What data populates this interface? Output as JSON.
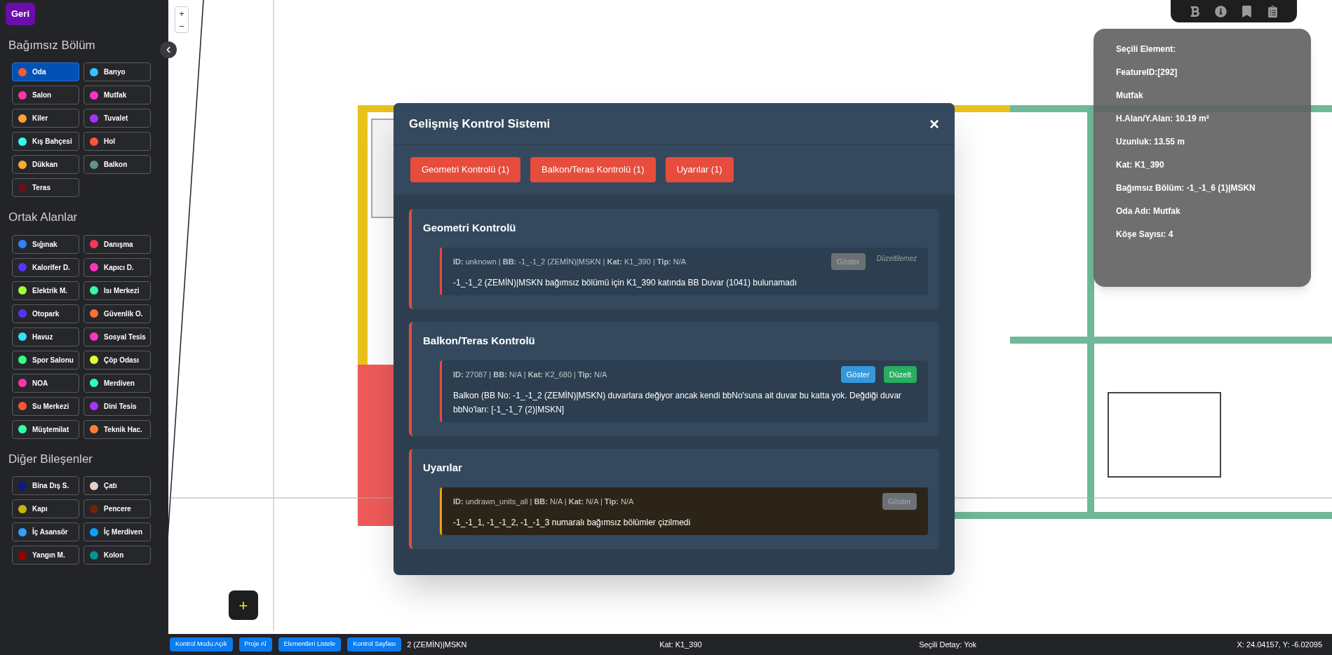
{
  "back_button": "Geri",
  "groups": [
    {
      "title": "Bağımsız Bölüm",
      "items": [
        {
          "label": "Oda",
          "color": "#ff5733",
          "selected": true
        },
        {
          "label": "Banyo",
          "color": "#33c4ff",
          "selected": false
        },
        {
          "label": "Salon",
          "color": "#ff33a8",
          "selected": false
        },
        {
          "label": "Mutfak",
          "color": "#ff33c4",
          "selected": false
        },
        {
          "label": "Kiler",
          "color": "#ffa033",
          "selected": false
        },
        {
          "label": "Tuvalet",
          "color": "#a833ff",
          "selected": false
        },
        {
          "label": "Kış Bahçesi",
          "color": "#33fff0",
          "selected": false
        },
        {
          "label": "Hol",
          "color": "#ff5733",
          "selected": false
        },
        {
          "label": "Dükkan",
          "color": "#ffaa33",
          "selected": false
        },
        {
          "label": "Balkon",
          "color": "#5f9490",
          "selected": false
        },
        {
          "label": "Teras",
          "color": "#6b0f1e",
          "selected": false
        }
      ]
    },
    {
      "title": "Ortak Alanlar",
      "items": [
        {
          "label": "Sığınak",
          "color": "#3380ff",
          "selected": false
        },
        {
          "label": "Danışma",
          "color": "#ff3358",
          "selected": false
        },
        {
          "label": "Kalorifer D.",
          "color": "#5733ff",
          "selected": false
        },
        {
          "label": "Kapıcı D.",
          "color": "#ff33c4",
          "selected": false
        },
        {
          "label": "Elektrik M.",
          "color": "#a0ff33",
          "selected": false
        },
        {
          "label": "Isı Merkezi",
          "color": "#33ffa0",
          "selected": false
        },
        {
          "label": "Otopark",
          "color": "#5733ff",
          "selected": false
        },
        {
          "label": "Güvenlik O.",
          "color": "#ff7033",
          "selected": false
        },
        {
          "label": "Havuz",
          "color": "#33e0ff",
          "selected": false
        },
        {
          "label": "Sosyal Tesis",
          "color": "#ff33c4",
          "selected": false
        },
        {
          "label": "Spor Salonu",
          "color": "#33ff80",
          "selected": false
        },
        {
          "label": "Çöp Odası",
          "color": "#e0ff33",
          "selected": false
        },
        {
          "label": "NOA",
          "color": "#ff33a8",
          "selected": false
        },
        {
          "label": "Merdiven",
          "color": "#33ffb0",
          "selected": false
        },
        {
          "label": "Su Merkezi",
          "color": "#ff5733",
          "selected": false
        },
        {
          "label": "Dini Tesis",
          "color": "#a833ff",
          "selected": false
        },
        {
          "label": "Müştemilat",
          "color": "#33ffa8",
          "selected": false
        },
        {
          "label": "Teknik Hac.",
          "color": "#ff8033",
          "selected": false
        }
      ]
    },
    {
      "title": "Diğer Bileşenler",
      "items": [
        {
          "label": "Bina Dış S.",
          "color": "#0a1a8a",
          "selected": false
        },
        {
          "label": "Çatı",
          "color": "#e8cfc4",
          "selected": false
        },
        {
          "label": "Kapı",
          "color": "#c9b40c",
          "selected": false
        },
        {
          "label": "Pencere",
          "color": "#6b2410",
          "selected": false
        },
        {
          "label": "İç Asansör",
          "color": "#33a0ff",
          "selected": false
        },
        {
          "label": "İç Merdiven",
          "color": "#0aa0ff",
          "selected": false
        },
        {
          "label": "Yangın M.",
          "color": "#990000",
          "selected": false
        },
        {
          "label": "Kolon",
          "color": "#0a9490",
          "selected": false
        }
      ]
    }
  ],
  "zoom_controls": [
    "+",
    "−"
  ],
  "add_button": "+",
  "toolbar": [
    {
      "kind": "bold"
    },
    {
      "kind": "info"
    },
    {
      "kind": "bookmark"
    },
    {
      "kind": "list"
    }
  ],
  "info_panel": {
    "lines": [
      "Seçili Element:",
      "FeatureID:[292]",
      "Mutfak",
      "H.Alan/Y.Alan: 10.19 m²",
      "Uzunluk: 13.55 m",
      "Kat: K1_390",
      "Bağımsız Bölüm: -1_-1_6 (1)|MSKN",
      "Oda Adı: Mutfak",
      "Köşe Sayısı: 4"
    ]
  },
  "modal": {
    "title": "Gelişmiş Kontrol Sistemi",
    "close": "×",
    "tabs": [
      "Geometri Kontrolü (1)",
      "Balkon/Teras Kontrolü (1)",
      "Uyarılar (1)"
    ],
    "sections": [
      {
        "title": "Geometri Kontrolü",
        "items": [
          {
            "kind": "error",
            "meta": "**ID:** unknown | **BB:** -1_-1_2 (ZEMİN)|MSKN | **Kat:** K1_390 | **Tip:** N/A",
            "message": "-1_-1_2 (ZEMİN)|MSKN bağımsız bölümü için K1_390 katında BB Duvar (1041) bulunamadı",
            "show_button": {
              "label": "Göster",
              "disabled": true
            },
            "note": "Düzeltilemez"
          }
        ]
      },
      {
        "title": "Balkon/Teras Kontrolü",
        "items": [
          {
            "kind": "error",
            "meta": "**ID:** 27087 | **BB:** N/A | **Kat:** K2_680 | **Tip:** N/A",
            "message": "Balkon (BB No: -1_-1_2 (ZEMİN)|MSKN) duvarlara değiyor ancak kendi bbNo'suna ait duvar bu katta yok. Değdiği duvar bbNo'ları: [-1_-1_7 (2)|MSKN]",
            "show_button": {
              "label": "Göster",
              "disabled": false
            },
            "fix_button": "Düzelt"
          }
        ]
      },
      {
        "title": "Uyarılar",
        "items": [
          {
            "kind": "warning",
            "meta": "**ID:** undrawn_units_all | **BB:** N/A | **Kat:** N/A | **Tip:** N/A",
            "message": "-1_-1_1, -1_-1_2, -1_-1_3 numaralı bağımsız bölümler çizilmedi",
            "show_button": {
              "label": "Göster",
              "disabled": true
            }
          }
        ]
      }
    ]
  },
  "status_bar": {
    "buttons": [
      "Kontrol Modu:Açık",
      "Proje Al",
      "Elementleri Listele",
      "Kontrol Sayfası"
    ],
    "unit": "2 (ZEMİN)|MSKN",
    "floor": "Kat: K1_390",
    "detail": "Seçili Detay: Yok",
    "coords": "X: 24.04157, Y: -6.02095"
  }
}
